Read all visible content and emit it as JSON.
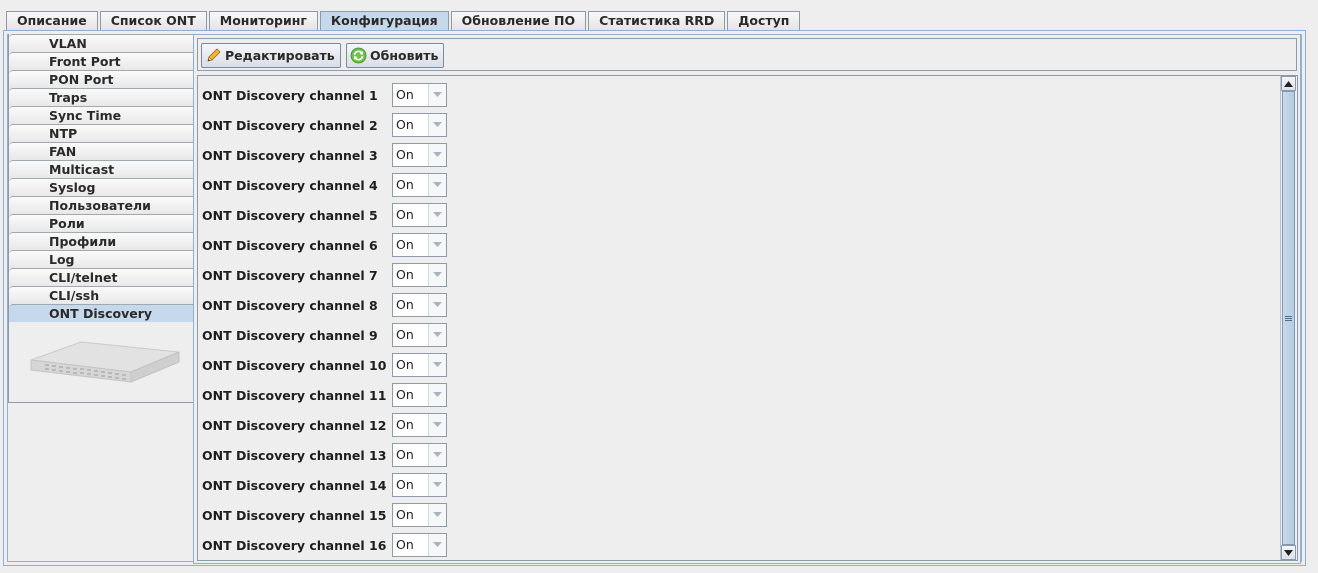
{
  "top_tabs": [
    {
      "label": "Описание",
      "active": false
    },
    {
      "label": "Список ONT",
      "active": false
    },
    {
      "label": "Мониторинг",
      "active": false
    },
    {
      "label": "Конфигурация",
      "active": true
    },
    {
      "label": "Обновление ПО",
      "active": false
    },
    {
      "label": "Статистика RRD",
      "active": false
    },
    {
      "label": "Доступ",
      "active": false
    }
  ],
  "sidebar": {
    "items": [
      {
        "label": "VLAN",
        "active": false
      },
      {
        "label": "Front Port",
        "active": false
      },
      {
        "label": "PON Port",
        "active": false
      },
      {
        "label": "Traps",
        "active": false
      },
      {
        "label": "Sync Time",
        "active": false
      },
      {
        "label": "NTP",
        "active": false
      },
      {
        "label": "FAN",
        "active": false
      },
      {
        "label": "Multicast",
        "active": false
      },
      {
        "label": "Syslog",
        "active": false
      },
      {
        "label": "Пользователи",
        "active": false
      },
      {
        "label": "Роли",
        "active": false
      },
      {
        "label": "Профили",
        "active": false
      },
      {
        "label": "Log",
        "active": false
      },
      {
        "label": "CLI/telnet",
        "active": false
      },
      {
        "label": "CLI/ssh",
        "active": false
      },
      {
        "label": "ONT Discovery",
        "active": true
      }
    ],
    "device_image_icon": "olt-device-icon"
  },
  "toolbar": {
    "edit_label": "Редактировать",
    "edit_icon": "pencil-icon",
    "refresh_label": "Обновить",
    "refresh_icon": "refresh-icon"
  },
  "channels": [
    {
      "label": "ONT Discovery channel 1",
      "value": "On"
    },
    {
      "label": "ONT Discovery channel 2",
      "value": "On"
    },
    {
      "label": "ONT Discovery channel 3",
      "value": "On"
    },
    {
      "label": "ONT Discovery channel 4",
      "value": "On"
    },
    {
      "label": "ONT Discovery channel 5",
      "value": "On"
    },
    {
      "label": "ONT Discovery channel 6",
      "value": "On"
    },
    {
      "label": "ONT Discovery channel 7",
      "value": "On"
    },
    {
      "label": "ONT Discovery channel 8",
      "value": "On"
    },
    {
      "label": "ONT Discovery channel 9",
      "value": "On"
    },
    {
      "label": "ONT Discovery channel 10",
      "value": "On"
    },
    {
      "label": "ONT Discovery channel 11",
      "value": "On"
    },
    {
      "label": "ONT Discovery channel 12",
      "value": "On"
    },
    {
      "label": "ONT Discovery channel 13",
      "value": "On"
    },
    {
      "label": "ONT Discovery channel 14",
      "value": "On"
    },
    {
      "label": "ONT Discovery channel 15",
      "value": "On"
    },
    {
      "label": "ONT Discovery channel 16",
      "value": "On"
    }
  ],
  "colors": {
    "active_tab": "#c6d8ec",
    "frame_border": "#8fb0d2",
    "background": "#eeeeee"
  }
}
